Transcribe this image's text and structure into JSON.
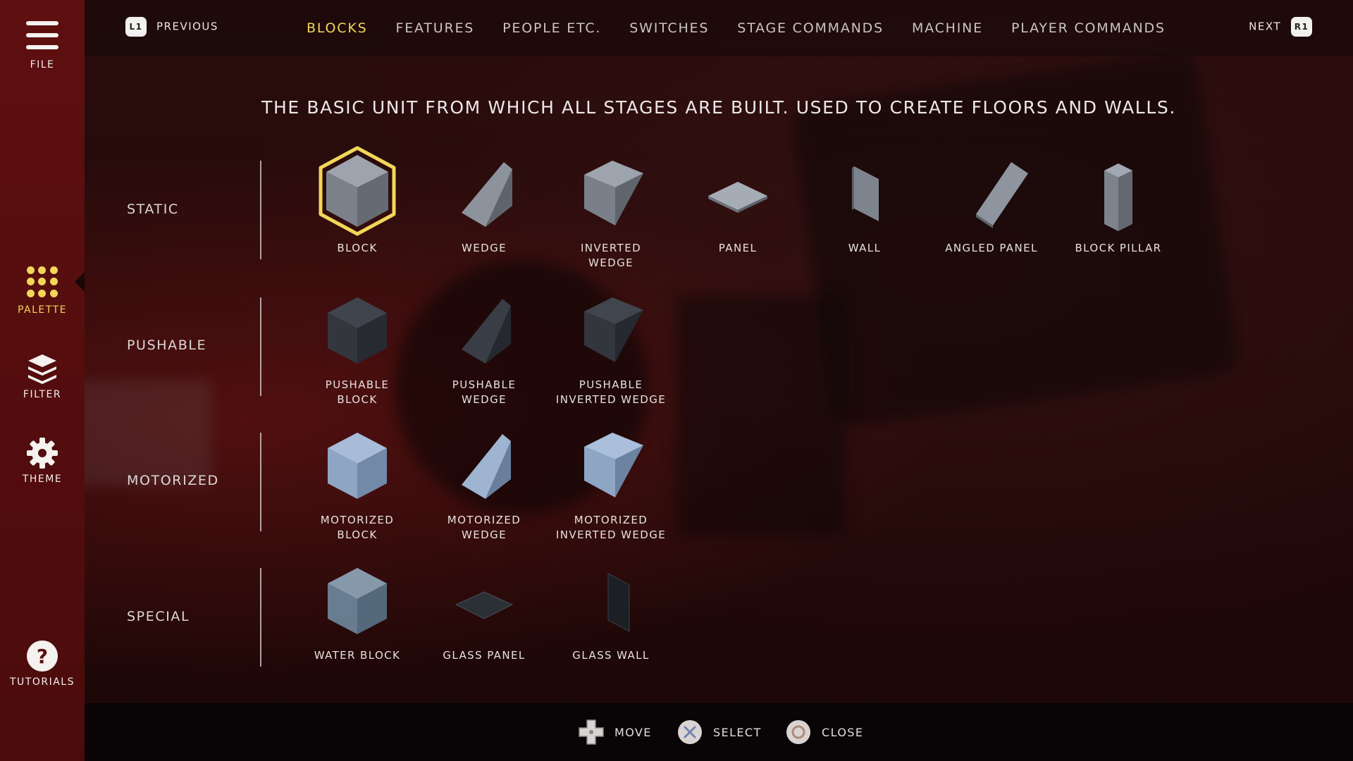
{
  "sidebar": {
    "items": [
      {
        "label": "FILE",
        "icon": "hamburger-menu-icon"
      },
      {
        "label": "PALETTE",
        "icon": "palette-dots-icon",
        "active": true
      },
      {
        "label": "FILTER",
        "icon": "layers-icon"
      },
      {
        "label": "THEME",
        "icon": "gear-icon"
      },
      {
        "label": "TUTORIALS",
        "icon": "help-icon"
      }
    ]
  },
  "topbar": {
    "prev_key": "L1",
    "prev_label": "PREVIOUS",
    "next_key": "R1",
    "next_label": "NEXT",
    "tabs": [
      {
        "label": "BLOCKS",
        "active": true
      },
      {
        "label": "FEATURES"
      },
      {
        "label": "PEOPLE ETC."
      },
      {
        "label": "SWITCHES"
      },
      {
        "label": "STAGE COMMANDS"
      },
      {
        "label": "MACHINE"
      },
      {
        "label": "PLAYER COMMANDS"
      }
    ]
  },
  "description": "THE BASIC UNIT FROM WHICH ALL STAGES ARE BUILT. USED TO CREATE FLOORS AND WALLS.",
  "rows": [
    {
      "label": "STATIC",
      "items": [
        {
          "label": "BLOCK",
          "selected": true
        },
        {
          "label": "WEDGE"
        },
        {
          "label": "INVERTED\nWEDGE"
        },
        {
          "label": "PANEL"
        },
        {
          "label": "WALL"
        },
        {
          "label": "ANGLED PANEL"
        },
        {
          "label": "BLOCK PILLAR"
        }
      ]
    },
    {
      "label": "PUSHABLE",
      "items": [
        {
          "label": "PUSHABLE\nBLOCK"
        },
        {
          "label": "PUSHABLE\nWEDGE"
        },
        {
          "label": "PUSHABLE\nINVERTED WEDGE"
        }
      ]
    },
    {
      "label": "MOTORIZED",
      "items": [
        {
          "label": "MOTORIZED\nBLOCK"
        },
        {
          "label": "MOTORIZED\nWEDGE"
        },
        {
          "label": "MOTORIZED\nINVERTED WEDGE"
        }
      ]
    },
    {
      "label": "SPECIAL",
      "items": [
        {
          "label": "WATER BLOCK"
        },
        {
          "label": "GLASS PANEL"
        },
        {
          "label": "GLASS WALL"
        }
      ]
    }
  ],
  "bottombar": {
    "hints": [
      {
        "label": "MOVE",
        "icon": "dpad-icon"
      },
      {
        "label": "SELECT",
        "icon": "cross-button-icon"
      },
      {
        "label": "CLOSE",
        "icon": "circle-button-icon"
      }
    ]
  },
  "colors": {
    "accent": "#f2d65a",
    "sidebar": "#5a0e0f",
    "static_top": "#9aa0aa",
    "pushable_top": "#3f434b",
    "motorized_top": "#a9c0df"
  }
}
